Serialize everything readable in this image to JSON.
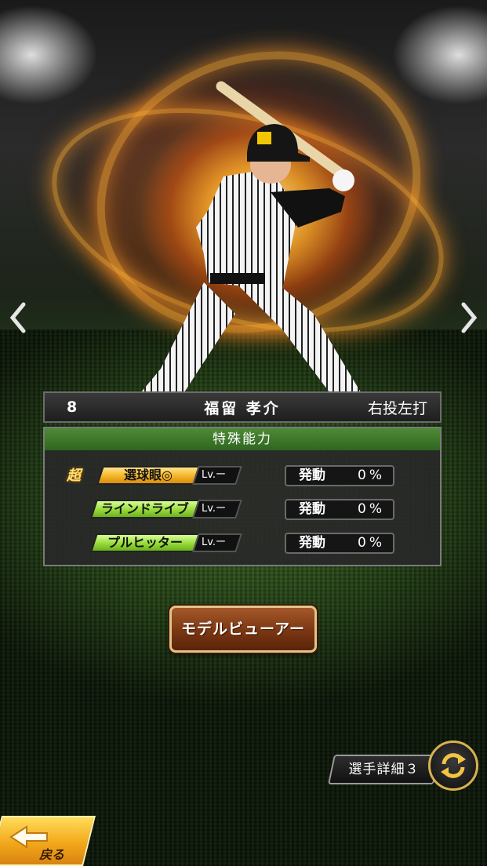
{
  "player": {
    "number": "8",
    "name": "福留 孝介",
    "throw_bat": "右投左打"
  },
  "abilities": {
    "header": "特殊能力",
    "items": [
      {
        "super_mark": "超",
        "name": "選球眼◎",
        "lv": "Lv.ー",
        "activate_label": "発動",
        "activate_value": "0%",
        "tier": "gold"
      },
      {
        "super_mark": "",
        "name": "ラインドライブ",
        "lv": "Lv.ー",
        "activate_label": "発動",
        "activate_value": "0%",
        "tier": "green"
      },
      {
        "super_mark": "",
        "name": "プルヒッター",
        "lv": "Lv.ー",
        "activate_label": "発動",
        "activate_value": "0%",
        "tier": "green"
      }
    ]
  },
  "buttons": {
    "model_viewer": "モデルビューアー",
    "player_detail": "選手詳細３",
    "back": "戻る"
  },
  "icons": {
    "prev": "chevron-left-icon",
    "next": "chevron-right-icon",
    "detail": "rotate-arrows-icon",
    "back": "back-arrow-icon"
  },
  "colors": {
    "ability_header": "#3f7b2c",
    "gold_tag": "#f3b425",
    "green_tag": "#98d93a",
    "model_button": "#7a3612",
    "back_button": "#f2a81b"
  }
}
